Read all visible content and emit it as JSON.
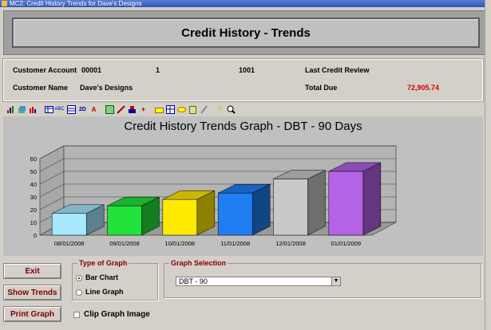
{
  "window": {
    "title": "MC2: Credit History Trends for Dave's Designs"
  },
  "header": {
    "title": "Credit History - Trends"
  },
  "info": {
    "account_label": "Customer Account",
    "account_value": "00001",
    "field2": "1",
    "field3": "1001",
    "last_review_label": "Last Credit Review",
    "name_label": "Customer Name",
    "name_value": "Dave's Designs",
    "total_due_label": "Total Due",
    "total_due_value": "72,905.74",
    "total_due_color": "#d00000"
  },
  "toolbar": {
    "icons": [
      "bar-graph-icon",
      "3d-graph-icon",
      "grouped-bar-icon",
      "data-table-icon",
      "text-abc-icon",
      "table-grid-icon",
      "2d-icon",
      "text-style-icon",
      "image-copy-icon",
      "tools-icon",
      "chart-edit-icon",
      "add-item-icon",
      "palette-icon",
      "gridlines-icon",
      "legend-icon",
      "clipboard-icon",
      "pen-icon",
      "help-icon",
      "zoom-icon"
    ]
  },
  "chart_data": {
    "type": "bar",
    "title": "Credit History Trends Graph - DBT - 90 Days",
    "categories": [
      "08/01/2008",
      "09/01/2008",
      "10/01/2008",
      "11/01/2008",
      "12/01/2008",
      "01/01/2009"
    ],
    "values": [
      17,
      23,
      28,
      33,
      44,
      50
    ],
    "colors": [
      "#a8e8ff",
      "#22e33a",
      "#ffea00",
      "#1f7ff2",
      "#c8c8c8",
      "#b463e6"
    ],
    "yticks": [
      "0",
      "10",
      "20",
      "30",
      "40",
      "50",
      "60"
    ],
    "ylim": [
      0,
      60
    ],
    "three_d": true
  },
  "buttons": {
    "exit": "Exit",
    "show_trends": "Show Trends",
    "print_graph": "Print Graph"
  },
  "type_of_graph": {
    "title": "Type of Graph",
    "options": [
      "Bar Chart",
      "Line Graph"
    ],
    "selected": "Bar Chart"
  },
  "graph_selection": {
    "title": "Graph Selection",
    "value": "DBT - 90"
  },
  "clip": {
    "label": "Clip Graph Image",
    "checked": false
  }
}
